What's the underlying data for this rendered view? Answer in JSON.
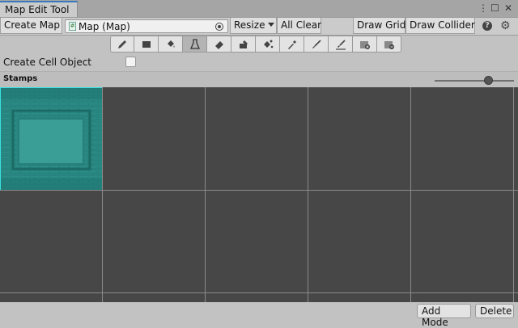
{
  "window": {
    "tab_title": "Map Edit Tool",
    "controls": {
      "menu": "⋮",
      "maximize": "☐",
      "close": "✕"
    }
  },
  "toolbar": {
    "create_map": "Create Map",
    "map_field_value": "Map (Map)",
    "resize": "Resize",
    "all_clear": "All Clear",
    "draw_grid": "Draw Grid",
    "draw_collider": "Draw Collider",
    "help": "?",
    "settings": "⚙"
  },
  "tools": [
    {
      "name": "pencil",
      "active": false
    },
    {
      "name": "rectangle",
      "active": false
    },
    {
      "name": "bucket-fill",
      "active": false
    },
    {
      "name": "flask",
      "active": true
    },
    {
      "name": "eraser",
      "active": false
    },
    {
      "name": "eraser-fill",
      "active": false
    },
    {
      "name": "bucket-magic",
      "active": false
    },
    {
      "name": "eyedropper",
      "active": false
    },
    {
      "name": "brush",
      "active": false
    },
    {
      "name": "brush-line",
      "active": false
    },
    {
      "name": "add-layer",
      "active": false
    },
    {
      "name": "remove-layer",
      "active": false
    }
  ],
  "options": {
    "create_cell_object_label": "Create Cell Object",
    "create_cell_object_checked": false
  },
  "stamps": {
    "label": "Stamps",
    "zoom_fraction": 0.7,
    "selected_index": 0
  },
  "footer": {
    "add_mode": "Add Mode",
    "delete": "Delete"
  },
  "colors": {
    "selection_border": "#39e0e0",
    "stamp_tile": "#1f7d77",
    "grid_background": "#474747",
    "tab_accent": "#3a79bb"
  }
}
